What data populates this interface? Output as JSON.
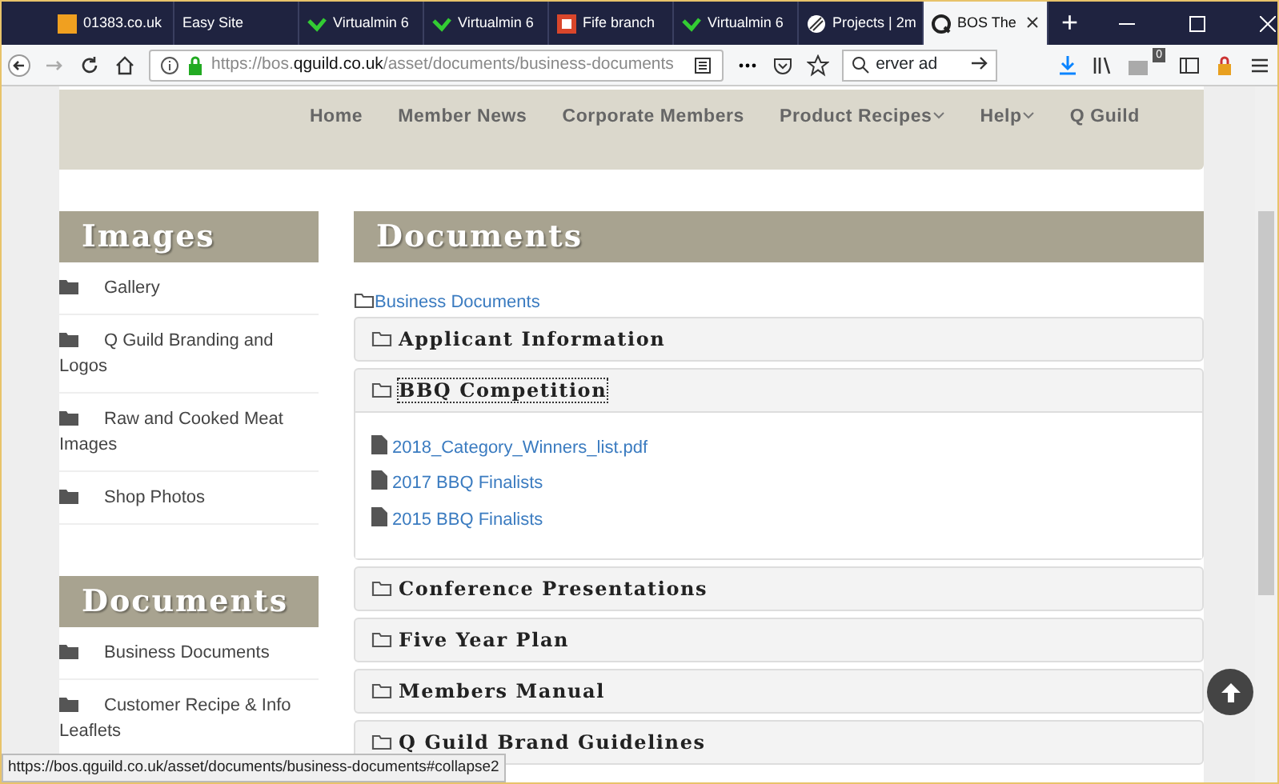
{
  "browser": {
    "tabs": [
      {
        "title": "01383.co.uk",
        "selected": false,
        "kind": "orange"
      },
      {
        "title": "Easy Site",
        "selected": false,
        "kind": "none"
      },
      {
        "title": "Virtualmin 6",
        "selected": false,
        "kind": "check"
      },
      {
        "title": "Virtualmin 6",
        "selected": false,
        "kind": "check"
      },
      {
        "title": "Fife branch",
        "selected": false,
        "kind": "tk"
      },
      {
        "title": "Virtualmin 6",
        "selected": false,
        "kind": "check"
      },
      {
        "title": "Projects | 2m",
        "selected": false,
        "kind": "stripes"
      },
      {
        "title": "BOS The",
        "selected": true,
        "kind": "q"
      }
    ],
    "new_tab": "+",
    "url_host": "https://bos.**qguild.co.uk**/asset/documents/business-documents",
    "search_value": "erver ad",
    "library_badge": "0"
  },
  "site_nav": [
    {
      "label": "Home",
      "dropdown": false
    },
    {
      "label": "Member News",
      "dropdown": false
    },
    {
      "label": "Corporate Members",
      "dropdown": false
    },
    {
      "label": "Product Recipes",
      "dropdown": true
    },
    {
      "label": "Help",
      "dropdown": true
    },
    {
      "label": "Q Guild",
      "dropdown": false
    }
  ],
  "sidebar": [
    {
      "title": "Images",
      "items": [
        "Gallery",
        "Q Guild Branding and Logos",
        "Raw and Cooked Meat Images",
        "Shop Photos"
      ]
    },
    {
      "title": "Documents",
      "items": [
        "Business Documents",
        "Customer Recipe & Info Leaflets"
      ]
    }
  ],
  "main": {
    "title": "Documents",
    "breadcrumb": "Business Documents",
    "panels": [
      {
        "title": "Applicant Information",
        "expanded": false
      },
      {
        "title": "BBQ Competition",
        "expanded": true,
        "files": [
          "2018_Category_Winners_list.pdf",
          "2017 BBQ Finalists",
          "2015 BBQ Finalists"
        ]
      },
      {
        "title": "Conference Presentations",
        "expanded": false
      },
      {
        "title": "Five Year Plan",
        "expanded": false
      },
      {
        "title": "Members Manual",
        "expanded": false
      },
      {
        "title": "Q Guild Brand Guidelines",
        "expanded": false
      }
    ]
  },
  "status_bar": "https://bos.qguild.co.uk/asset/documents/business-documents#collapse2"
}
